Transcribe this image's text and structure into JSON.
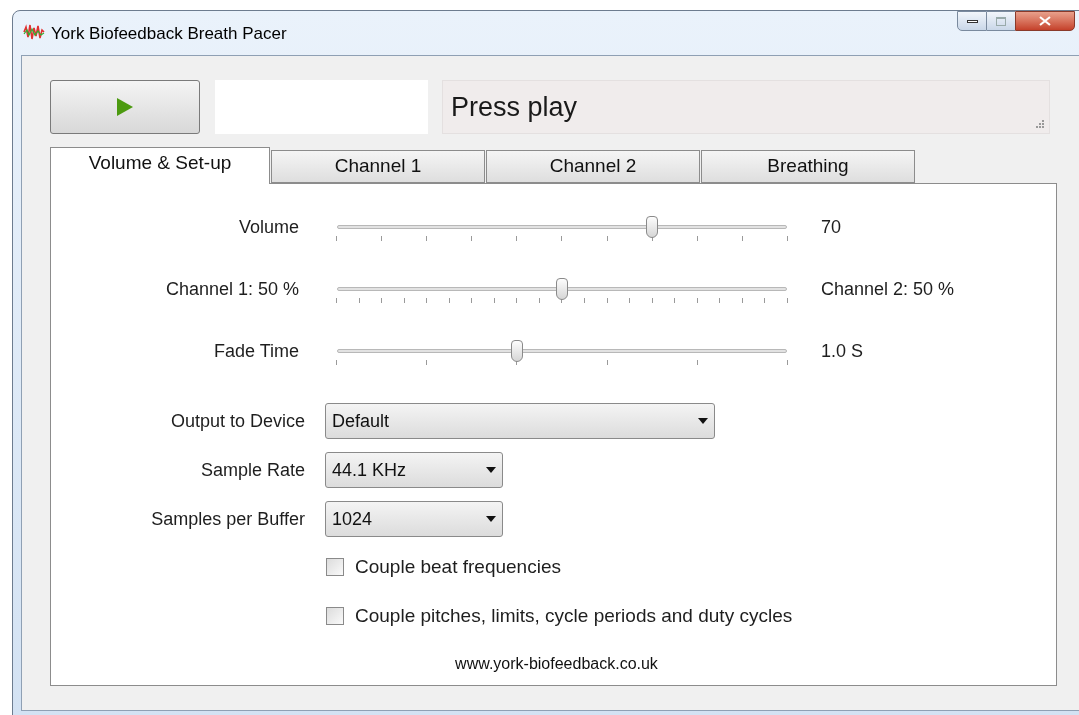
{
  "window": {
    "title": "York Biofeedback Breath Pacer"
  },
  "toolbar": {
    "status": "Press play"
  },
  "tabs": [
    {
      "label": "Volume & Set-up",
      "selected": true
    },
    {
      "label": "Channel 1",
      "selected": false
    },
    {
      "label": "Channel 2",
      "selected": false
    },
    {
      "label": "Breathing",
      "selected": false
    }
  ],
  "sliders": [
    {
      "label": "Volume",
      "level": 0.7,
      "reading": "70",
      "kind": "tenths"
    },
    {
      "label": "Channel 1: 50 %",
      "level": 0.5,
      "reading": "Channel 2: 50 %",
      "kind": "twentieths"
    },
    {
      "label": "Fade Time",
      "level": 0.4,
      "reading": "1.0 S",
      "kind": "fifths"
    }
  ],
  "dropdowns": [
    {
      "label": "Output to Device",
      "value": "Default",
      "kind": "wide"
    },
    {
      "label": "Sample Rate",
      "value": "44.1 KHz",
      "kind": "narrow"
    },
    {
      "label": "Samples per Buffer",
      "value": "1024",
      "kind": "narrow"
    }
  ],
  "checkboxes": [
    {
      "label": "Couple beat frequencies",
      "checked": false
    },
    {
      "label": "Couple pitches, limits, cycle periods and duty cycles",
      "checked": false
    }
  ],
  "footer": {
    "link": "www.york-biofeedback.co.uk"
  }
}
